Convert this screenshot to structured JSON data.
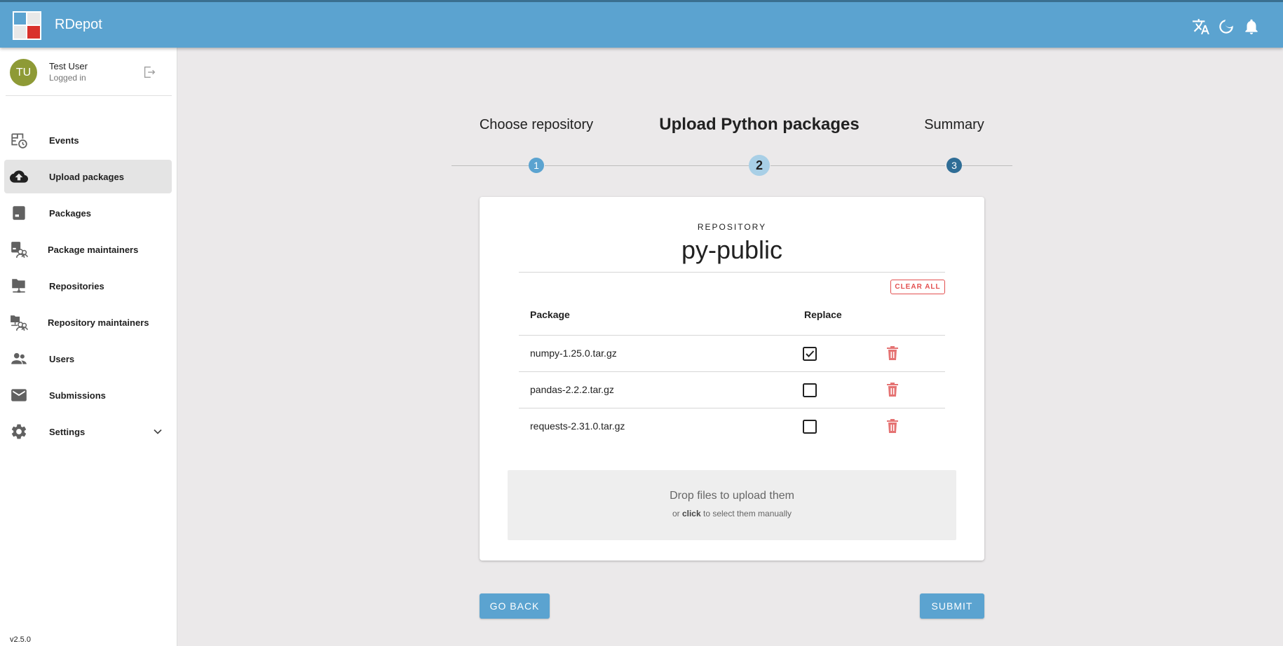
{
  "app": {
    "title": "RDepot"
  },
  "appbar": {
    "icons": [
      "translate-icon",
      "dark-mode-icon",
      "notifications-icon"
    ]
  },
  "user": {
    "initials": "TU",
    "name": "Test User",
    "status": "Logged in"
  },
  "sidebar": {
    "items": [
      {
        "label": "Events",
        "icon": "events-icon",
        "active": false
      },
      {
        "label": "Upload packages",
        "icon": "cloud-upload-icon",
        "active": true
      },
      {
        "label": "Packages",
        "icon": "package-icon",
        "active": false
      },
      {
        "label": "Package maintainers",
        "icon": "package-maintainers-icon",
        "active": false
      },
      {
        "label": "Repositories",
        "icon": "folder-network-icon",
        "active": false
      },
      {
        "label": "Repository maintainers",
        "icon": "repository-maintainers-icon",
        "active": false
      },
      {
        "label": "Users",
        "icon": "users-icon",
        "active": false
      },
      {
        "label": "Submissions",
        "icon": "mail-icon",
        "active": false
      },
      {
        "label": "Settings",
        "icon": "gear-icon",
        "active": false
      }
    ],
    "version": "v2.5.0"
  },
  "stepper": {
    "steps": [
      {
        "title": "Choose repository",
        "number": "1"
      },
      {
        "title": "Upload Python packages",
        "number": "2"
      },
      {
        "title": "Summary",
        "number": "3"
      }
    ],
    "current": 2
  },
  "card": {
    "repo_label": "REPOSITORY",
    "repo_name": "py-public",
    "clear_all": "CLEAR ALL",
    "columns": {
      "package": "Package",
      "replace": "Replace"
    },
    "rows": [
      {
        "name": "numpy-1.25.0.tar.gz",
        "replace": true
      },
      {
        "name": "pandas-2.2.2.tar.gz",
        "replace": false
      },
      {
        "name": "requests-2.31.0.tar.gz",
        "replace": false
      }
    ],
    "dropzone": {
      "title": "Drop files to upload them",
      "sub_prefix": "or",
      "sub_bold": "click",
      "sub_suffix": "to select them manually"
    }
  },
  "actions": {
    "back": "GO BACK",
    "submit": "SUBMIT"
  },
  "colors": {
    "primary": "#5ba3d0",
    "danger": "#e35050",
    "step_done": "#5ba3d0",
    "step_current": "#a8cfe6",
    "step_next": "#2f6d96"
  }
}
